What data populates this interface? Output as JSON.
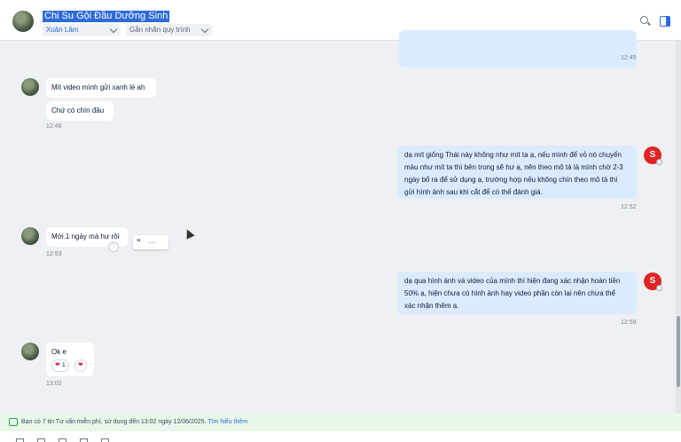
{
  "header": {
    "title": "Chi Su Gội Đầu Dưỡng Sinh",
    "assignee": "Xuân Lâm",
    "tag_placeholder": "Gắn nhãn quy trình"
  },
  "messages": {
    "m1_time": "12:45",
    "m2_text": "Mít video mình gửi xanh lè ah",
    "m3_text": "Chứ có chín đâu",
    "m3_time": "12:46",
    "m4_lines": [
      "dạ mít giống Thái này không như mít ta ạ, nếu mình để vỏ nó chuyển",
      "màu như mít ta thì bên trong sẽ hư ạ, nên theo mô tả là mình chờ 2-3",
      "ngày bổ ra để sử dụng ạ, trường hợp nếu không chín theo mô tả thì",
      "gửi hình ảnh sau khi cắt để có thể đánh giá."
    ],
    "m4_time": "12:52",
    "m5_text": "Mới.1 ngày mà hư rồi",
    "m5_time": "12:53",
    "m6_lines": [
      "dạ qua hình ảnh và video của mình thì hiện đang xác nhận hoàn tiền",
      "50% ạ, hiện chưa có hình ảnh hay video phần còn lại nên chưa thể",
      "xác nhận thêm ạ."
    ],
    "m6_time": "12:59",
    "m7_text": "Ok e",
    "m7_reaction_count": "1",
    "m7_time": "13:02"
  },
  "shop_avatar": "S",
  "footer": {
    "text": "Bạn có 7 tin Tư vấn miễn phí, sử dụng đến 13:02 ngày 12/06/2025.",
    "link": "Tìm hiểu thêm"
  }
}
